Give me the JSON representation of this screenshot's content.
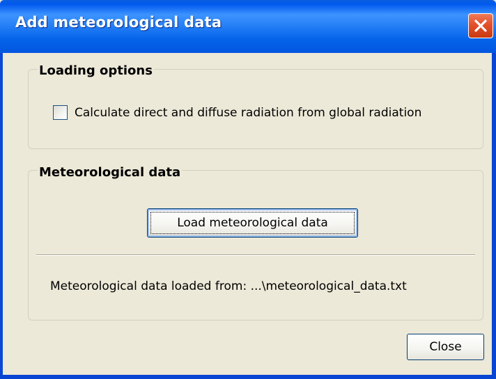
{
  "window": {
    "title": "Add meteorological data",
    "close_icon": "close-x-icon"
  },
  "loading_options": {
    "group_label": "Loading options",
    "checkbox_label": "Calculate direct and diffuse radiation from global radiation",
    "checkbox_checked": false
  },
  "meteorological_data": {
    "group_label": "Meteorological data",
    "load_button_label": "Load meteorological data",
    "status_text": "Meteorological data loaded from: ...\\meteorological_data.txt"
  },
  "footer": {
    "close_button_label": "Close"
  },
  "colors": {
    "titlebar": "#2a83f7",
    "dialog_background": "#ece9d8",
    "close_button": "#e4502c"
  }
}
